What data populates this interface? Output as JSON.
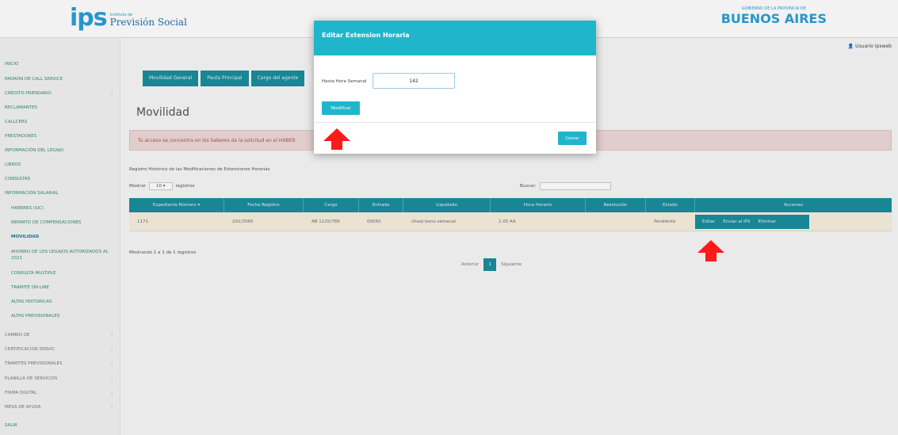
{
  "header": {
    "logo_mark": "ips",
    "logo_small": "Instituto de",
    "logo_name": "Previsión Social",
    "ba_small": "GOBIERNO DE LA PROVINCIA DE",
    "ba_big": "BUENOS AIRES",
    "user": "Usuario Ipsweb"
  },
  "sidebar": {
    "items": [
      "INICIO",
      "PADRÓN DE CALL SERVICE",
      "CREDITO PRENDARIO",
      "RECLAMANTES",
      "CALLCERS",
      "PRESTADORES",
      "INFORMACIÓN DEL LEGAJO",
      "LIBROS",
      "CONSULTAS",
      "INFORMACIÓN SALARIAL",
      "HABERES (SIC)",
      "REPARTO DE COMPENSACIONES",
      "MOVILIDAD",
      "AHORRO DE LOS LEGAJOS AUTORIZADOS AL 2021",
      "CONSULTA MULTIPLE",
      "TRAMITE ON LINE",
      "ALTAS HISTORICAS",
      "ALTAS PREVISIONALES",
      "CAMBIO DE",
      "CERTIFICACION SERVIC",
      "TRAMITES PREVISIONALES",
      "PLANILLA DE SERVICIOS",
      "FIRMA DIGITAL",
      "MESA DE AYUDA",
      "SALIR"
    ]
  },
  "main": {
    "tabs": [
      "Movilidad General",
      "Pauta Principal",
      "Cargo del agente"
    ],
    "title": "Movilidad",
    "alert": "Tu acceso se concentra en los haberes de la solicitud en el HABER",
    "table_caption": "Registro Histórico de las Modificaciones de Extensiones Horarias",
    "show_label": "Mostrar",
    "show_value": "10",
    "records_label": "registros",
    "search_label": "Buscar:",
    "columns": [
      "Expediente Número",
      "Fecha Registro",
      "Cargo",
      "Entrada",
      "Liquidado",
      "Hora Horario",
      "Resolución",
      "Estado",
      "Acciones"
    ],
    "rows": [
      {
        "cells": [
          "1171",
          "201/2060",
          "AB 1125/789",
          "00050",
          "cheat bono semanal",
          "1.05 AA",
          "",
          "Pendiente"
        ]
      }
    ],
    "row_actions": [
      "Editar",
      "Enviar al IPS",
      "Eliminar"
    ],
    "showing": "Mostrando 1 a 1 de 1 registros",
    "pager": {
      "prev": "Anterior",
      "page": "1",
      "next": "Siguiente"
    }
  },
  "modal": {
    "title": "Editar Extension Horaria",
    "field_label": "Hasta Hora Semanal",
    "field_value": "142",
    "modify_label": "Modificar",
    "close_label": "Cerrar"
  },
  "colors": {
    "accent": "#1a8e9e",
    "modal_header": "#1fb6cc",
    "arrow": "#ff1a1a",
    "alert_bg": "#eed8d8"
  }
}
